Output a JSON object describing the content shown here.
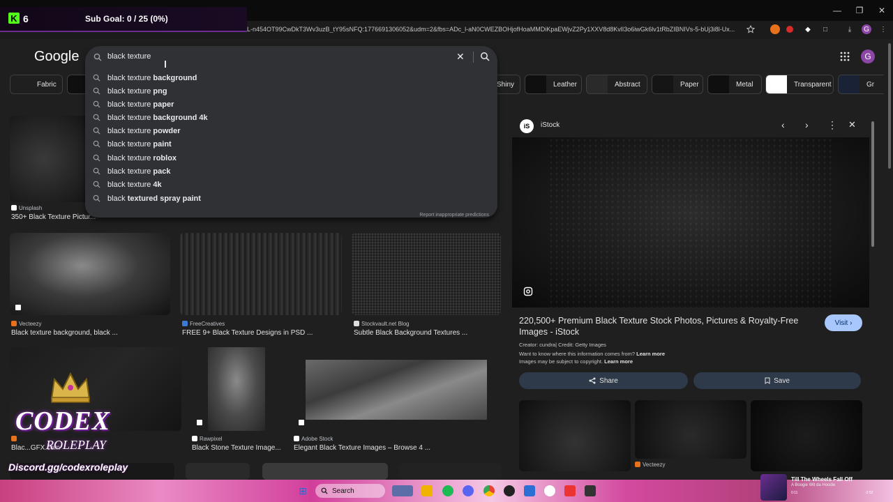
{
  "overlay": {
    "k_count": "6",
    "sub_goal": "Sub Goal: 0 / 25 (0%)"
  },
  "browser": {
    "url": "L-n454OT99CwDkT3Wv3uzB_tY95sNFQ:1776691306052&udm=2&fbs=ADc_l-aN0CWEZBOHjofHoaMMDiKpaEWjvZ2Py1XXV8d8KvlI3o6iwGk6lv1tRbZIBNIVs-5-bUj3i8l-Ux..."
  },
  "google": {
    "logo": "Google",
    "search_value": "black texture",
    "report_link": "Report inappropriate predictions",
    "avatar_letter": "G",
    "suggestions": [
      {
        "prefix": "black texture ",
        "bold": "background"
      },
      {
        "prefix": "black texture ",
        "bold": "png"
      },
      {
        "prefix": "black texture ",
        "bold": "paper"
      },
      {
        "prefix": "black texture ",
        "bold": "background 4k"
      },
      {
        "prefix": "black texture ",
        "bold": "powder"
      },
      {
        "prefix": "black texture ",
        "bold": "paint"
      },
      {
        "prefix": "black texture ",
        "bold": "roblox"
      },
      {
        "prefix": "black texture ",
        "bold": "pack"
      },
      {
        "prefix": "black texture ",
        "bold": "4k"
      },
      {
        "prefix": "black ",
        "bold": "textured spray paint"
      }
    ]
  },
  "chips": [
    "Fabric",
    "Shiny",
    "Leather",
    "Abstract",
    "Paper",
    "Metal",
    "Transparent",
    "Gr"
  ],
  "results": [
    {
      "source": "Unsplash",
      "caption": "350+ Black Texture Pictur..."
    },
    {
      "source": "Vecteezy",
      "caption": "Black texture background, black ..."
    },
    {
      "source": "FreeCreatives",
      "caption": "FREE 9+ Black Texture Designs in PSD ..."
    },
    {
      "source": "Stockvault.net Blog",
      "caption": "Subtle Black Background Textures ..."
    },
    {
      "source": "",
      "caption": "Blac...GFX.com"
    },
    {
      "source": "Rawpixel",
      "caption": "Black Stone Texture Image..."
    },
    {
      "source": "Adobe Stock",
      "caption": "Elegant Black Texture Images – Browse 4 ..."
    }
  ],
  "panel": {
    "source": "iStock",
    "favicon": "iS",
    "title": "220,500+ Premium Black Texture Stock Photos, Pictures & Royalty-Free Images - iStock",
    "visit": "Visit",
    "creator": "Creator: cundra| Credit: Getty Images",
    "info_q": "Want to know where this information comes from?",
    "learn_more_1": "Learn more",
    "copyright": "Images may be subject to copyright.",
    "learn_more_2": "Learn more",
    "share": "Share",
    "save": "Save",
    "related_source": "Vecteezy"
  },
  "branding": {
    "name": "CODEX",
    "sub": "ROLEPLAY",
    "discord": "Discord.gg/codexroleplay"
  },
  "taskbar": {
    "search": "Search",
    "media_title": "Till The Wheels Fall Off",
    "media_artist": "A Boogie Wit da Hoodie",
    "time_elapsed": "0:11",
    "time_left": "-2:52"
  },
  "colors": {
    "accent": "#a8c7fa",
    "kick_green": "#53fc18",
    "overlay_purple": "#6b2d8f",
    "surface": "#303134"
  }
}
